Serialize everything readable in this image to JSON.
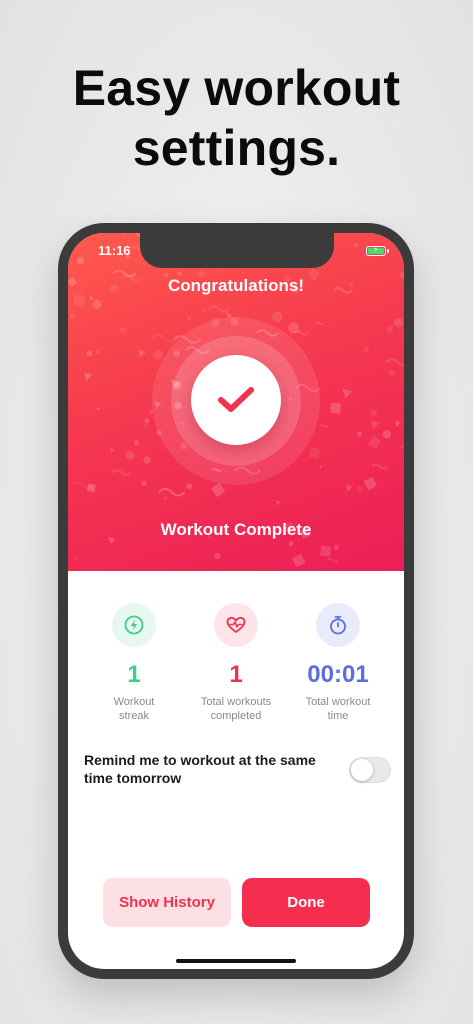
{
  "headline": {
    "line1": "Easy workout",
    "line2": "settings."
  },
  "status_bar": {
    "time": "11:16",
    "battery_icon": "battery-charging-icon"
  },
  "hero": {
    "title": "Congratulations!",
    "subtitle": "Workout Complete",
    "icon": "checkmark-icon",
    "colors": {
      "gradient_start": "#ff5a4c",
      "gradient_end": "#ec1e57"
    }
  },
  "stats": [
    {
      "icon": "lightning-icon",
      "value": "1",
      "label_line1": "Workout",
      "label_line2": "streak",
      "color": "#3ccf8a",
      "bg": "#e6f8ef"
    },
    {
      "icon": "heart-pulse-icon",
      "value": "1",
      "label_line1": "Total workouts",
      "label_line2": "completed",
      "color": "#f0324f",
      "bg": "#fde4e8"
    },
    {
      "icon": "stopwatch-icon",
      "value": "00:01",
      "label_line1": "Total workout",
      "label_line2": "time",
      "color": "#5a6ee0",
      "bg": "#e8ebfb"
    }
  ],
  "reminder": {
    "label": "Remind me to workout at the same time tomorrow",
    "enabled": false
  },
  "buttons": {
    "history": "Show History",
    "done": "Done"
  }
}
